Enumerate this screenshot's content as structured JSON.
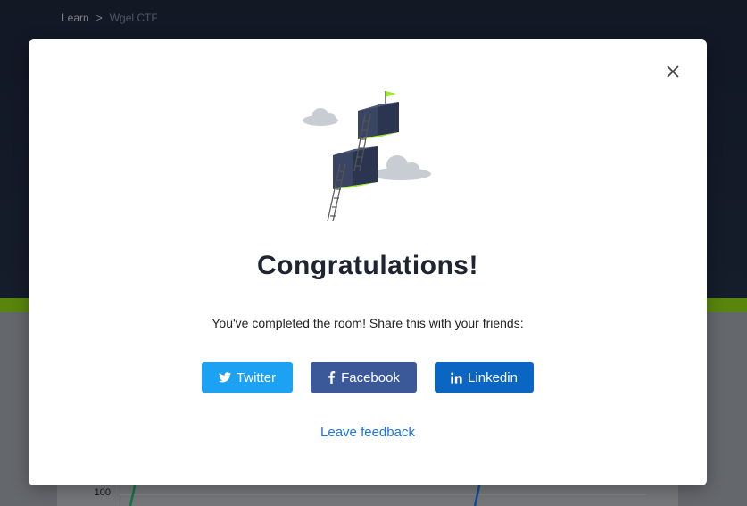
{
  "breadcrumb": {
    "items": [
      "Learn",
      "Wgel CTF"
    ],
    "separator": ">"
  },
  "background_chart": {
    "tick_label": "100"
  },
  "modal": {
    "title": "Congratulations!",
    "subtitle": "You've completed the room! Share this with your friends:",
    "share_buttons": [
      {
        "label": "Twitter",
        "icon": "twitter-icon",
        "color": "#1da1f2"
      },
      {
        "label": "Facebook",
        "icon": "facebook-icon",
        "color": "#3b5998"
      },
      {
        "label": "Linkedin",
        "icon": "linkedin-icon",
        "color": "#0a66c2"
      }
    ],
    "feedback_link": "Leave feedback",
    "close_icon": "close-icon"
  },
  "colors": {
    "accent_green": "#88cc14",
    "page_dark": "#1c2538",
    "link_blue": "#1a73e8"
  }
}
